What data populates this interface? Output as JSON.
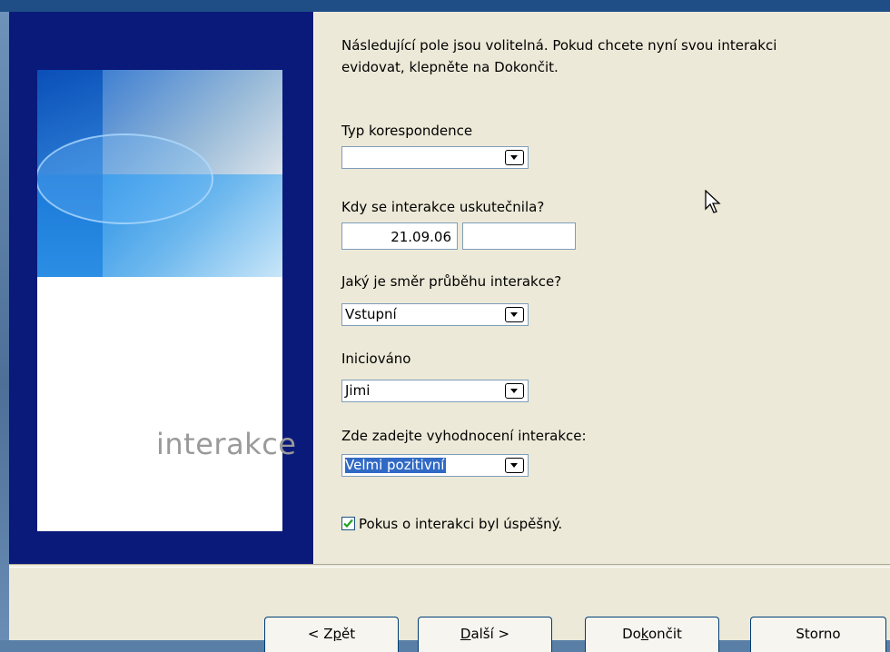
{
  "intro_text": {
    "line1": "Následující pole jsou volitelná. Pokud chcete nyní svou interakci",
    "line2": "evidovat, klepněte na Dokončit."
  },
  "banner": {
    "text": "interakce"
  },
  "fields": {
    "correspondence_type": {
      "label": "Typ korespondence",
      "value": ""
    },
    "when": {
      "label": "Kdy se interakce uskutečnila?",
      "date": "21.09.06",
      "time": ""
    },
    "direction": {
      "label": "Jaký je směr průběhu interakce?",
      "value": "Vstupní"
    },
    "initiated": {
      "label": "Iniciováno",
      "value": "Jimi"
    },
    "evaluation": {
      "label": "Zde zadejte vyhodnocení interakce:",
      "value": "Velmi pozitivní"
    },
    "success_checkbox": {
      "label": "Pokus o interakci byl úspěšný.",
      "checked": true
    }
  },
  "buttons": {
    "back": {
      "pre": "< Z",
      "mnemonic": "p",
      "post": "ět"
    },
    "next": {
      "pre": "",
      "mnemonic": "D",
      "post": "alší >"
    },
    "finish": {
      "pre": "Do",
      "mnemonic": "k",
      "post": "ončit"
    },
    "cancel": {
      "label": "Storno"
    }
  },
  "colors": {
    "banner": "#0a1a7a",
    "dialog": "#ece9d8",
    "selection": "#316ac5",
    "checkmark": "#21a121"
  }
}
